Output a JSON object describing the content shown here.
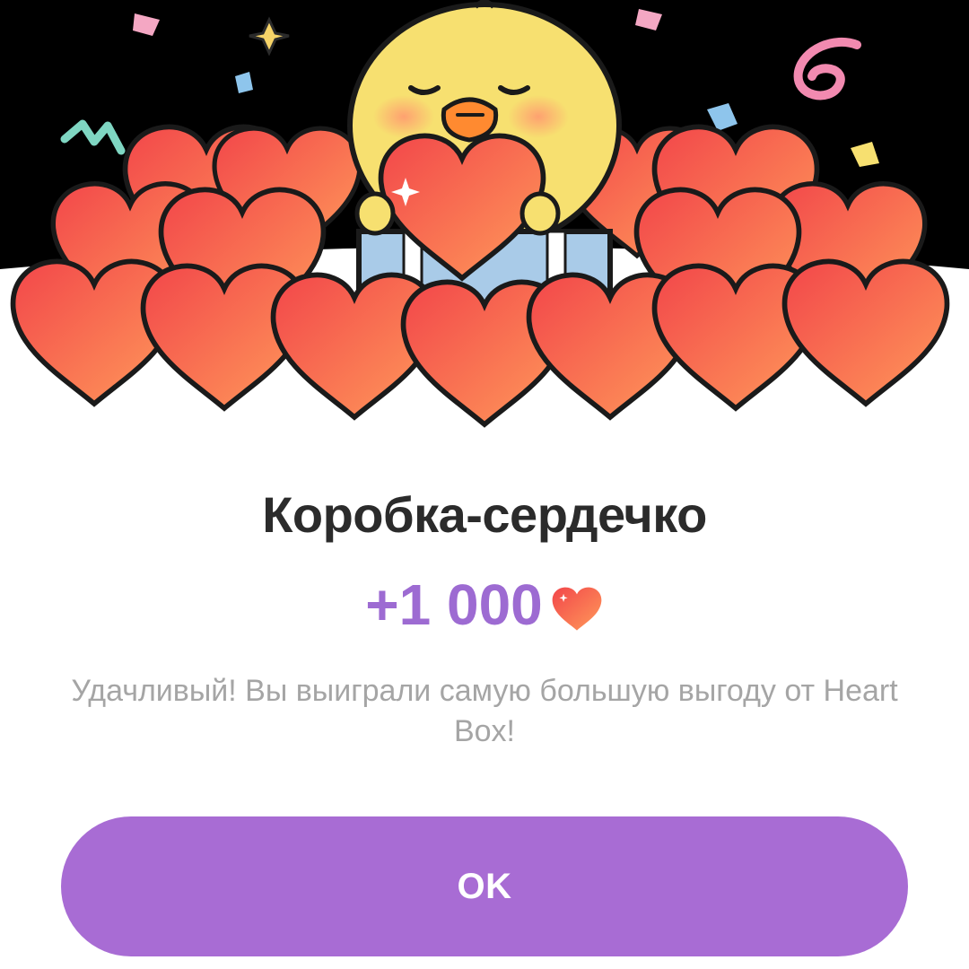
{
  "dialog": {
    "title": "Коробка-сердечко",
    "reward_amount": "+1 000",
    "reward_icon": "heart-icon",
    "description": "Удачливый! Вы выиграли самую большую выгоду от Heart Box!",
    "ok_button_label": "OK"
  },
  "colors": {
    "accent": "#a86cd4",
    "reward_text": "#9d6bd2",
    "title_text": "#2b2b2b",
    "description_text": "#a5a5a5",
    "heart_light": "#ff9a5a",
    "heart_dark": "#f2464a",
    "banner_background": "#000000"
  }
}
